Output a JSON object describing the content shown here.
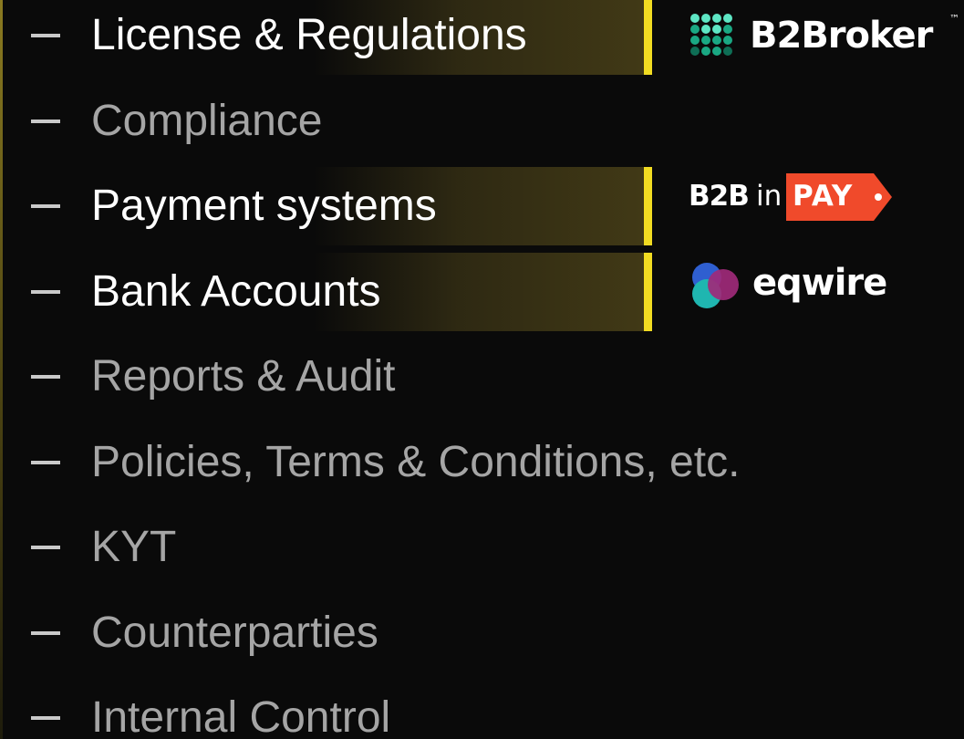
{
  "items": [
    {
      "label": "License & Regulations",
      "active": true
    },
    {
      "label": "Compliance",
      "active": false
    },
    {
      "label": "Payment systems",
      "active": true
    },
    {
      "label": "Bank Accounts",
      "active": true
    },
    {
      "label": "Reports & Audit",
      "active": false
    },
    {
      "label": "Policies, Terms & Conditions, etc.",
      "active": false
    },
    {
      "label": "KYT",
      "active": false
    },
    {
      "label": "Counterparties",
      "active": false
    },
    {
      "label": "Internal Control",
      "active": false
    }
  ],
  "logos": {
    "b2broker": {
      "text": "B2Broker",
      "tm": "™",
      "icon": "dot-grid-icon",
      "colors": [
        "#5ee6c4",
        "#1aa883",
        "#0e6e55"
      ]
    },
    "b2binpay": {
      "b2b": "B2B",
      "in": "in",
      "pay": "PAY",
      "tag_color": "#f04a2b",
      "icon": "price-tag-icon"
    },
    "eqwire": {
      "text": "eqwire",
      "icon": "overlapping-circles-icon",
      "colors": [
        "#2f5fd0",
        "#1fb6b0",
        "#a02a7a"
      ]
    }
  },
  "colors": {
    "background": "#0a0a0a",
    "active_text": "#ffffff",
    "inactive_text": "#a5a5a5",
    "accent_bar": "#f2dc22",
    "highlight_gradient_end": "#423a16"
  }
}
